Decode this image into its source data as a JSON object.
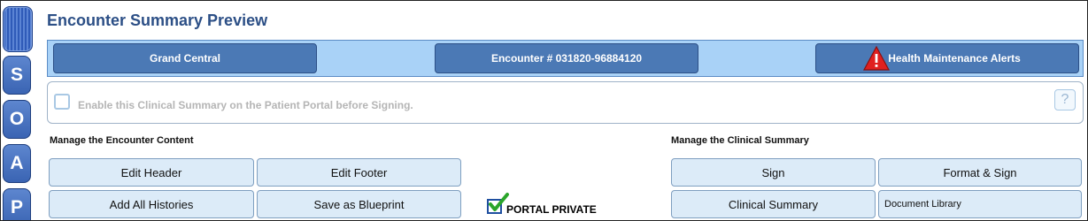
{
  "rail": {
    "tabs": [
      "S",
      "O",
      "A",
      "P"
    ]
  },
  "header": {
    "title": "Encounter Summary Preview"
  },
  "top_bar": {
    "grand_central": "Grand Central",
    "encounter": "Encounter # 031820-96884120",
    "alerts": "Health Maintenance Alerts"
  },
  "portal": {
    "enable_label": "Enable this Clinical Summary on the Patient Portal before Signing.",
    "help_label": "?",
    "enabled": false
  },
  "encounter_content": {
    "heading": "Manage the Encounter Content",
    "edit_header": "Edit Header",
    "edit_footer": "Edit Footer",
    "add_all_histories": "Add All Histories",
    "save_as_blueprint": "Save as Blueprint"
  },
  "portal_private": {
    "label": "PORTAL PRIVATE",
    "checked": true
  },
  "clinical_summary": {
    "heading": "Manage the Clinical Summary",
    "sign": "Sign",
    "format_sign": "Format & Sign",
    "clinical_summary": "Clinical Summary",
    "document_library": "Document Library"
  },
  "colors": {
    "title": "#2c4f86",
    "bar_background": "#a9d2f7",
    "bar_button": "#4b79b5",
    "action_button": "#dcebf8",
    "warning": "#e02020",
    "check_green": "#2aa52a"
  },
  "icons": {
    "warning": "warning-triangle-icon",
    "check": "green-check-icon",
    "help": "question-mark-icon"
  }
}
